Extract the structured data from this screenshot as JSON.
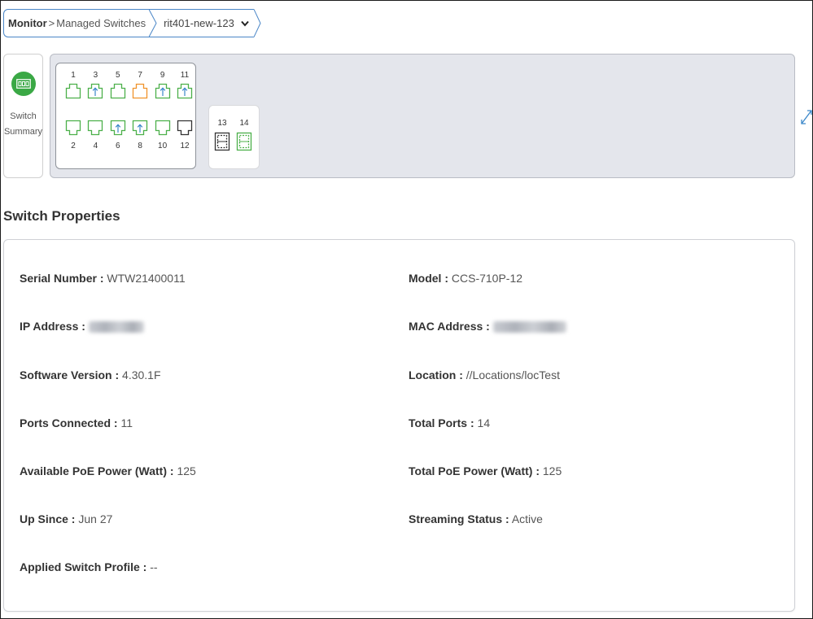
{
  "breadcrumb": {
    "root": "Monitor",
    "separator": ">",
    "child": "Managed Switches",
    "device": "rit401-new-123"
  },
  "summary_tile": {
    "icon": "switch-icon",
    "line1": "Switch",
    "line2": "Summary",
    "accent": "#3aa845"
  },
  "ports": {
    "top_row": [
      {
        "num": "1",
        "status": "connected",
        "uplink": false
      },
      {
        "num": "3",
        "status": "connected",
        "uplink": true
      },
      {
        "num": "5",
        "status": "connected",
        "uplink": false
      },
      {
        "num": "7",
        "status": "warning",
        "uplink": false
      },
      {
        "num": "9",
        "status": "connected",
        "uplink": true
      },
      {
        "num": "11",
        "status": "connected",
        "uplink": true
      }
    ],
    "bottom_row": [
      {
        "num": "2",
        "status": "connected",
        "uplink": false
      },
      {
        "num": "4",
        "status": "connected",
        "uplink": false
      },
      {
        "num": "6",
        "status": "connected",
        "uplink": true
      },
      {
        "num": "8",
        "status": "connected",
        "uplink": true
      },
      {
        "num": "10",
        "status": "connected",
        "uplink": false
      },
      {
        "num": "12",
        "status": "disconnected",
        "uplink": false
      }
    ],
    "sfp": [
      {
        "num": "13",
        "status": "disconnected"
      },
      {
        "num": "14",
        "status": "connected"
      }
    ],
    "colors": {
      "connected": "#4cb04a",
      "warning": "#f0932b",
      "disconnected": "#333333",
      "uplink_arrow": "#3a87c9"
    }
  },
  "section_title": "Switch Properties",
  "properties": {
    "serial_label": "Serial Number :",
    "serial_value": "WTW21400011",
    "model_label": "Model :",
    "model_value": "CCS-710P-12",
    "ip_label": "IP Address :",
    "mac_label": "MAC Address :",
    "software_label": "Software Version :",
    "software_value": "4.30.1F",
    "location_label": "Location :",
    "location_value": "//Locations/locTest",
    "ports_connected_label": "Ports Connected :",
    "ports_connected_value": "11",
    "total_ports_label": "Total Ports :",
    "total_ports_value": "14",
    "avail_poe_label": "Available PoE Power (Watt) :",
    "avail_poe_value": "125",
    "total_poe_label": "Total PoE Power (Watt) :",
    "total_poe_value": "125",
    "up_since_label": "Up Since :",
    "up_since_value": "Jun 27",
    "streaming_label": "Streaming Status :",
    "streaming_value": "Active",
    "profile_label": "Applied Switch Profile :",
    "profile_value": "--"
  }
}
